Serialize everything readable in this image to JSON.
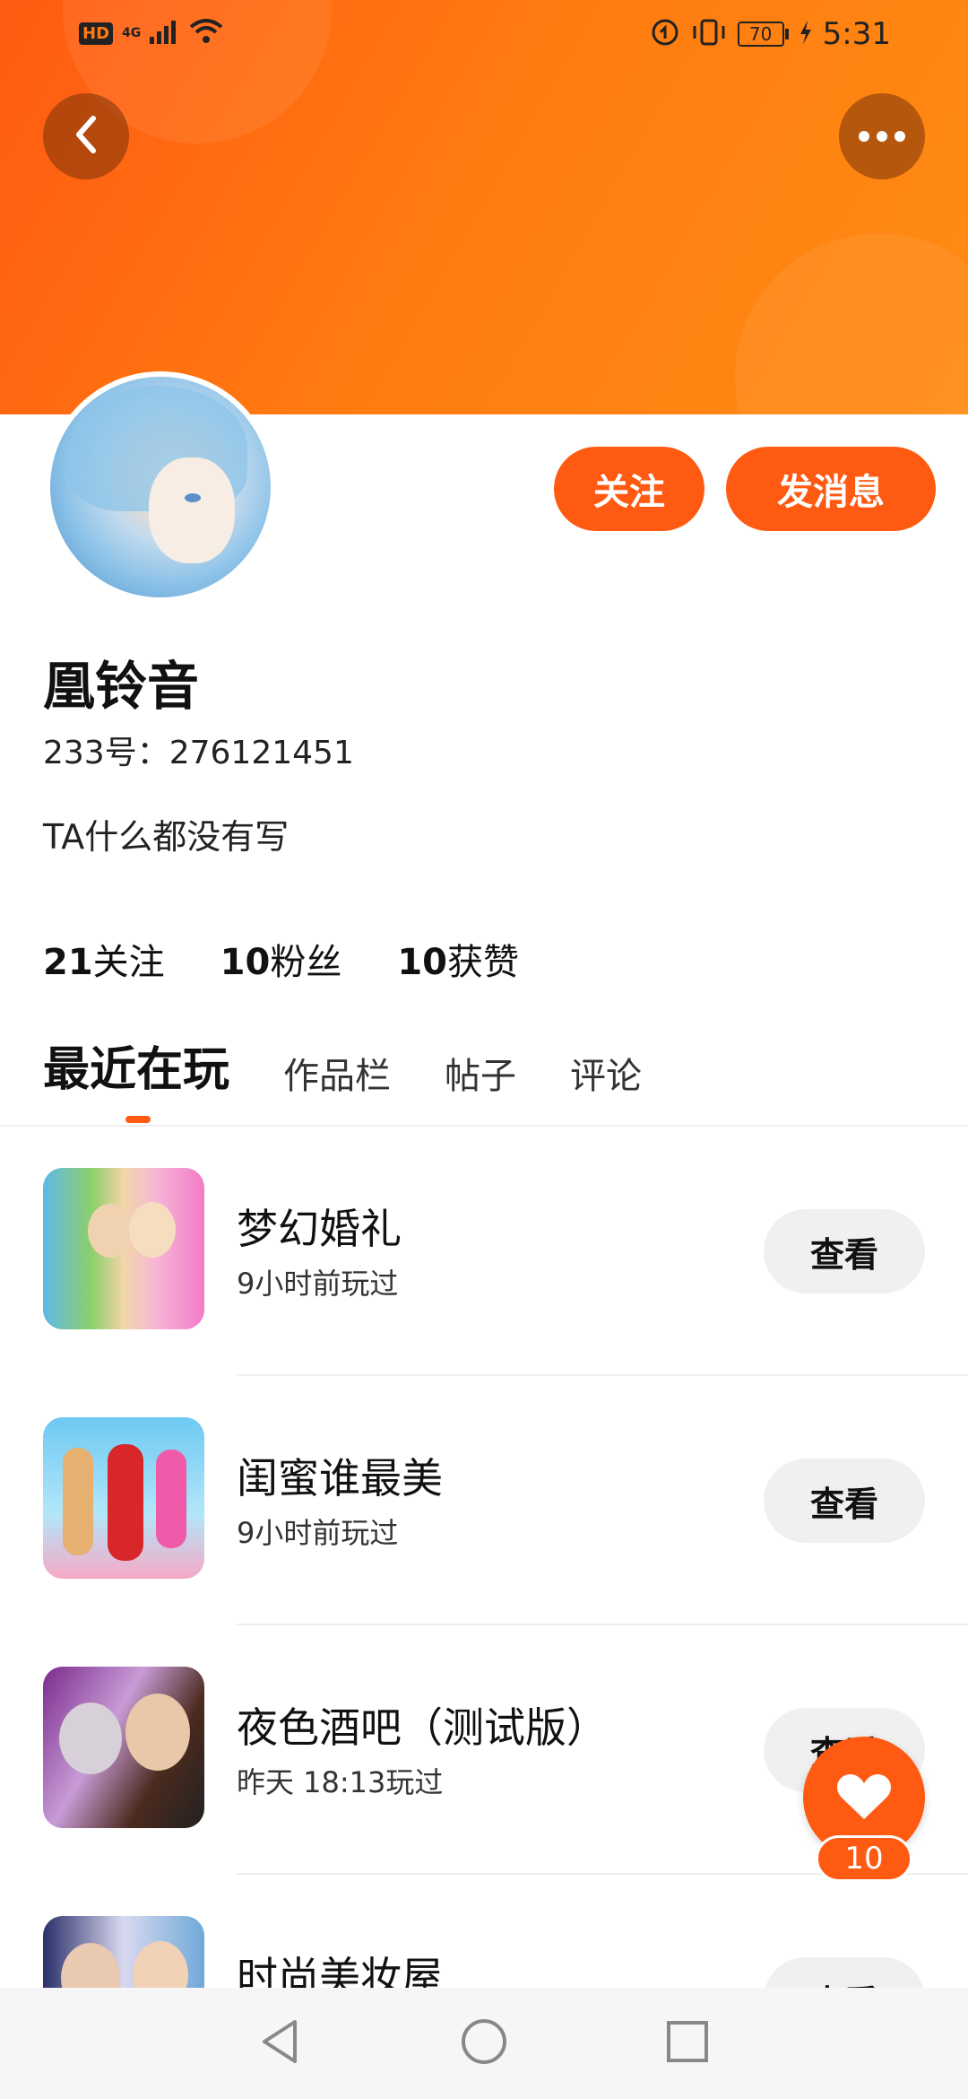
{
  "status_bar": {
    "hd": "HD",
    "network": "4G",
    "battery": "70",
    "time": "5:31"
  },
  "header": {
    "back_icon": "chevron-left-icon",
    "more_icon": "more-horizontal-icon",
    "follow_label": "关注",
    "message_label": "发消息"
  },
  "profile": {
    "name": "凰铃音",
    "uid": "233号：276121451",
    "bio": "TA什么都没有写",
    "stats": [
      {
        "num": "21",
        "label": "关注"
      },
      {
        "num": "10",
        "label": "粉丝"
      },
      {
        "num": "10",
        "label": "获赞"
      }
    ]
  },
  "tabs": [
    "最近在玩",
    "作品栏",
    "帖子",
    "评论"
  ],
  "games": [
    {
      "title": "梦幻婚礼",
      "time": "9小时前玩过",
      "button": "查看"
    },
    {
      "title": "闺蜜谁最美",
      "time": "9小时前玩过",
      "button": "查看"
    },
    {
      "title": "夜色酒吧（测试版）",
      "time": "昨天 18:13玩过",
      "button": "查看"
    },
    {
      "title": "时尚美妆屋",
      "time": "",
      "button": "查看"
    }
  ],
  "like": {
    "count": "10",
    "icon": "heart-icon"
  },
  "colors": {
    "accent": "#ff5a12",
    "header_gradient_end": "#ff8c14"
  }
}
